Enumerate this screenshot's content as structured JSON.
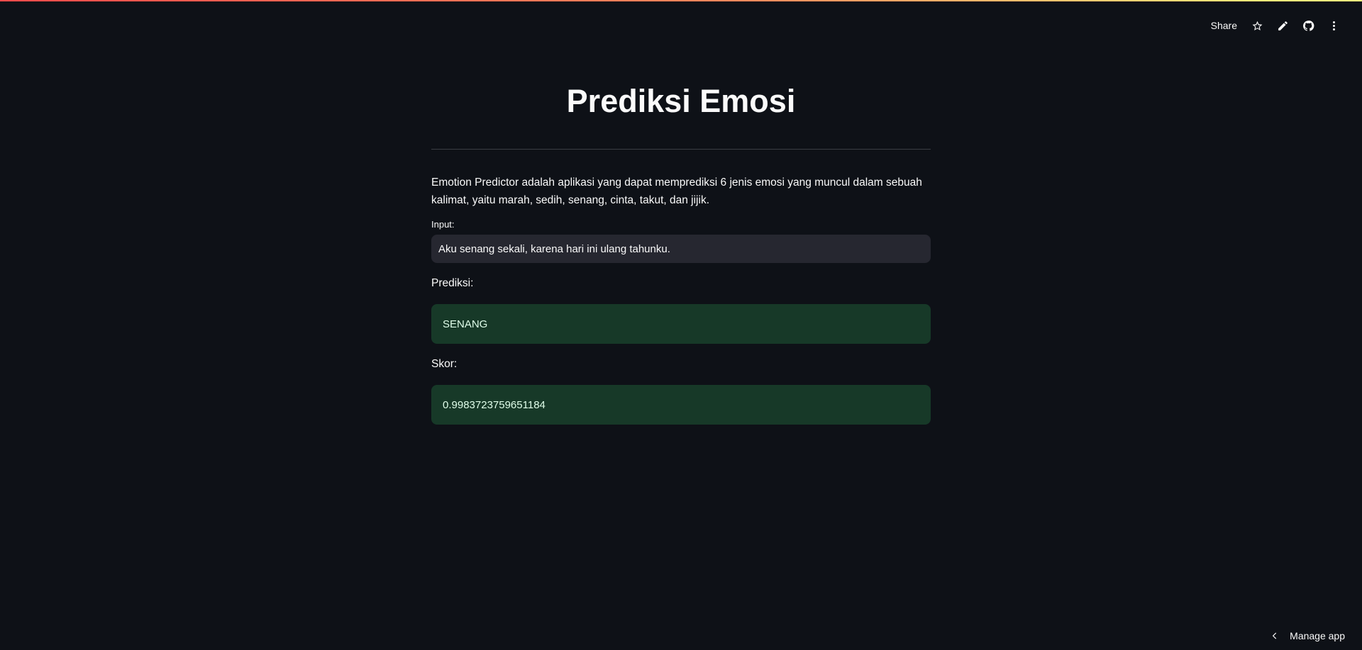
{
  "header": {
    "share_label": "Share",
    "icons": [
      "star-icon",
      "pencil-icon",
      "github-icon",
      "more-vertical-icon"
    ]
  },
  "main": {
    "title": "Prediksi Emosi",
    "description": "Emotion Predictor adalah aplikasi yang dapat memprediksi 6 jenis emosi yang muncul dalam sebuah kalimat, yaitu marah, sedih, senang, cinta, takut, dan jijik.",
    "input_label": "Input:",
    "input_value": "Aku senang sekali, karena hari ini ulang tahunku.",
    "prediction_label": "Prediksi:",
    "prediction_value": "SENANG",
    "score_label": "Skor:",
    "score_value": "0.9983723759651184"
  },
  "footer": {
    "manage_app_label": "Manage app"
  },
  "colors": {
    "background": "#0e1117",
    "input_bg": "#262730",
    "success_bg": "#173928",
    "success_text": "#dffde9",
    "accent_gradient_start": "#ff4b4b",
    "accent_gradient_end": "#fffd80"
  }
}
